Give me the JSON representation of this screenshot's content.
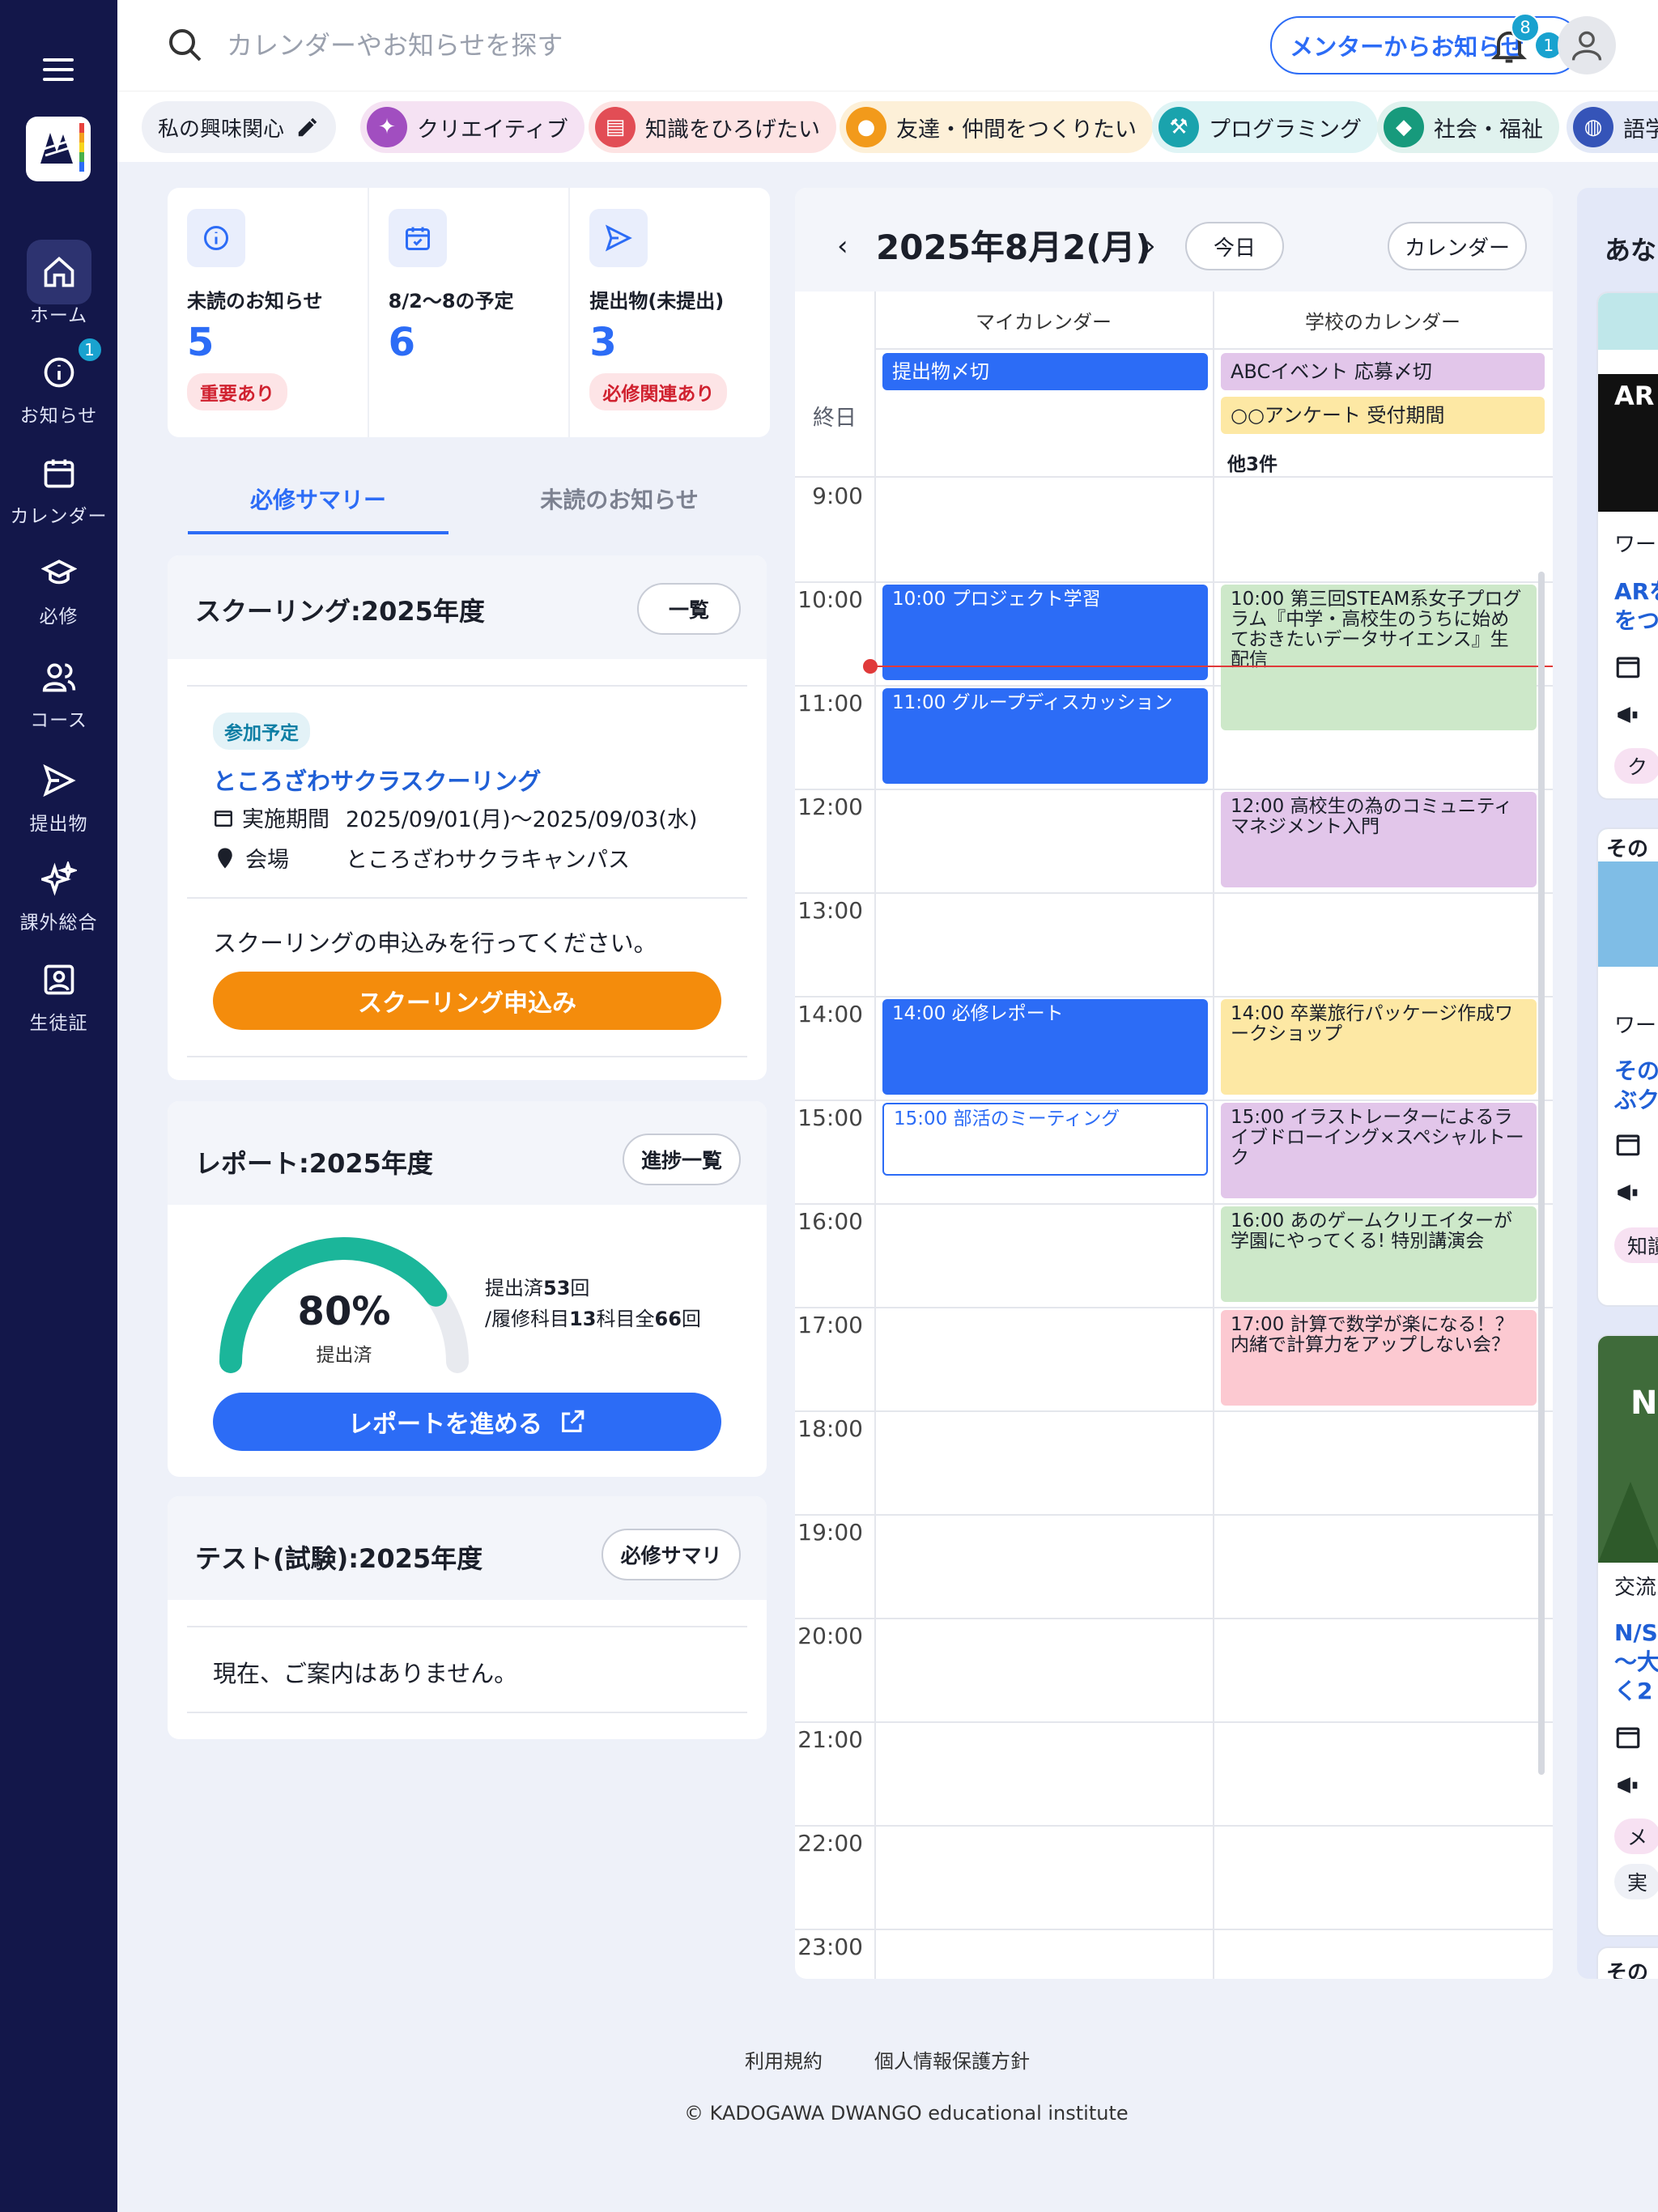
{
  "sidebar": {
    "items": [
      {
        "label": "ホーム"
      },
      {
        "label": "お知らせ",
        "badge": "1"
      },
      {
        "label": "カレンダー"
      },
      {
        "label": "必修"
      },
      {
        "label": "コース"
      },
      {
        "label": "提出物"
      },
      {
        "label": "課外総合"
      },
      {
        "label": "生徒証"
      }
    ]
  },
  "header": {
    "search_placeholder": "カレンダーやお知らせを探す",
    "mentor_label": "メンターからお知らせ",
    "mentor_count": "1",
    "bell_count": "8"
  },
  "interests": {
    "edit_label": "私の興味関心",
    "chips": [
      {
        "label": "クリエイティブ"
      },
      {
        "label": "知識をひろげたい"
      },
      {
        "label": "友達・仲間をつくりたい"
      },
      {
        "label": "プログラミング"
      },
      {
        "label": "社会・福祉"
      },
      {
        "label": "語学"
      }
    ]
  },
  "stats": [
    {
      "title": "未読のお知らせ",
      "value": "5",
      "tag": "重要あり"
    },
    {
      "title": "8/2〜8の予定",
      "value": "6",
      "tag": ""
    },
    {
      "title": "提出物(未提出)",
      "value": "3",
      "tag": "必修関連あり"
    }
  ],
  "tabs": {
    "active": "必修サマリー",
    "inactive": "未読のお知らせ"
  },
  "schooling": {
    "title": "スクーリング:2025年度",
    "list_button": "一覧",
    "status": "参加予定",
    "name": "ところざわサクラスクーリング",
    "period_label": "実施期間",
    "period_value": "2025/09/01(月)〜2025/09/03(水)",
    "venue_label": "会場",
    "venue_value": "ところざわサクラキャンパス",
    "notice": "スクーリングの申込みを行ってください。",
    "apply_button": "スクーリング申込み"
  },
  "report": {
    "title": "レポート:2025年度",
    "progress_button": "進捗一覧",
    "percent_text": "80%",
    "percent": 80,
    "caption": "提出済",
    "stats_line1_pre": "提出済",
    "stats_line1_num": "53",
    "stats_line1_post": "回",
    "stats_line2_pre": "/履修科目",
    "stats_line2_num1": "13",
    "stats_line2_mid": "科目全",
    "stats_line2_num2": "66",
    "stats_line2_post": "回",
    "action_button": "レポートを進める"
  },
  "test": {
    "title": "テスト(試験):2025年度",
    "summary_button": "必修サマリ",
    "empty": "現在、ご案内はありません。"
  },
  "calendar": {
    "date": "2025年8月2(月)",
    "today_button": "今日",
    "calendar_button": "カレンダー",
    "columns": [
      "マイカレンダー",
      "学校のカレンダー"
    ],
    "allday_label": "終日",
    "allday_my": [
      "提出物〆切"
    ],
    "allday_school": [
      "ABCイベント 応募〆切",
      "○○アンケート 受付期間"
    ],
    "more": "他3件",
    "hours": [
      "9:00",
      "10:00",
      "11:00",
      "12:00",
      "13:00",
      "14:00",
      "15:00",
      "16:00",
      "17:00",
      "18:00",
      "19:00",
      "20:00",
      "21:00",
      "22:00",
      "23:00"
    ],
    "events_my": [
      {
        "text": "10:00 プロジェクト学習",
        "style": "blue"
      },
      {
        "text": "11:00 グループディスカッション",
        "style": "blue"
      },
      {
        "text": "14:00 必修レポート",
        "style": "blue"
      },
      {
        "text": "15:00 部活のミーティング",
        "style": "outline"
      }
    ],
    "events_school": [
      {
        "text": "10:00 第三回STEAM系女子プログラム『中学・高校生のうちに始めておきたいデータサイエンス』生配信",
        "style": "green"
      },
      {
        "text": "12:00 高校生の為のコミュニティマネジメント入門",
        "style": "purple"
      },
      {
        "text": "14:00 卒業旅行パッケージ作成ワークショップ",
        "style": "yellow"
      },
      {
        "text": "15:00 イラストレーターによるライブドローイング×スペシャルトーク",
        "style": "purple"
      },
      {
        "text": "16:00 あのゲームクリエイターが学園にやってくる! 特別講演会",
        "style": "green"
      },
      {
        "text": "17:00 計算で数学が楽になる！？内緒で計算力をアップしない会？",
        "style": "pink"
      }
    ]
  },
  "recommend": {
    "title": "あな",
    "cards": [
      {
        "thumb_text": "AR",
        "category": "ワー",
        "name1": "ARを",
        "name2": "をつ",
        "tag": "ク"
      },
      {
        "thumb_text": "その",
        "category": "ワー",
        "name1": "その",
        "name2": "ぶク",
        "tag": "知讀"
      },
      {
        "thumb_text": "N",
        "category": "交流",
        "name1": "N/SU",
        "name2": "〜大",
        "name3": "く2",
        "tag": "メ",
        "tag2": "実"
      }
    ],
    "card4_text": "その"
  },
  "footer": {
    "terms": "利用規約",
    "privacy": "個人情報保護方針",
    "copyright": "© KADOGAWA DWANGO educational institute"
  },
  "colors": {
    "sidebar": "#13174a",
    "primary": "#2c6cf6",
    "orange": "#f48c0c",
    "gauge": "#1bb69a"
  }
}
